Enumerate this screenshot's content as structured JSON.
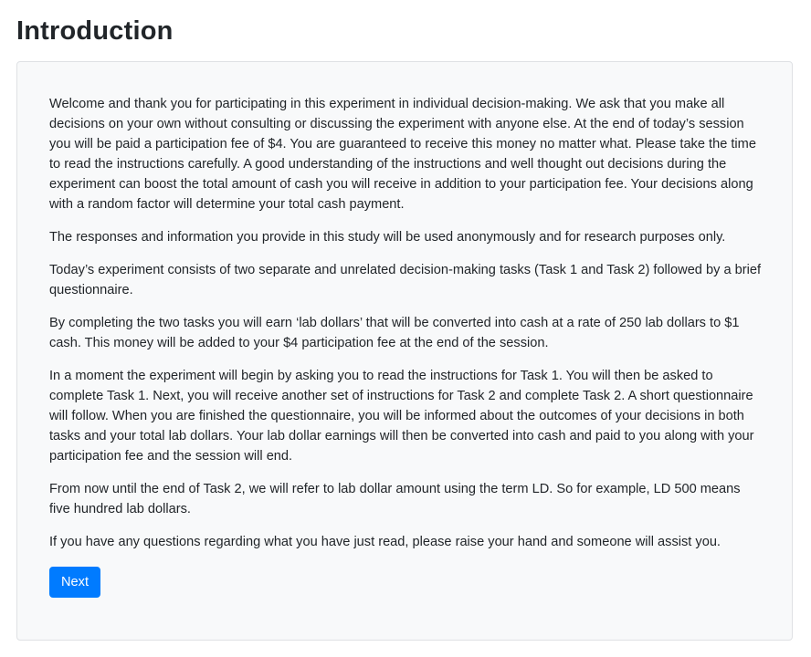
{
  "page": {
    "title": "Introduction"
  },
  "content": {
    "paragraphs": [
      "Welcome and thank you for participating in this experiment in individual decision-making. We ask that you make all decisions on your own without consulting or discussing the experiment with anyone else. At the end of today’s session you will be paid a participation fee of $4. You are guaranteed to receive this money no matter what. Please take the time to read the instructions carefully. A good understanding of the instructions and well thought out decisions during the experiment can boost the total amount of cash you will receive in addition to your participation fee. Your decisions along with a random factor will determine your total cash payment.",
      "The responses and information you provide in this study will be used anonymously and for research purposes only.",
      "Today’s experiment consists of two separate and unrelated decision-making tasks (Task 1 and Task 2) followed by a brief questionnaire.",
      "By completing the two tasks you will earn ‘lab dollars’ that will be converted into cash at a rate of 250 lab dollars to $1 cash. This money will be added to your $4 participation fee at the end of the session.",
      "In a moment the experiment will begin by asking you to read the instructions for Task 1. You will then be asked to complete Task 1. Next, you will receive another set of instructions for Task 2 and complete Task 2. A short questionnaire will follow. When you are finished the questionnaire, you will be informed about the outcomes of your decisions in both tasks and your total lab dollars. Your lab dollar earnings will then be converted into cash and paid to you along with your participation fee and the session will end.",
      "From now until the end of Task 2, we will refer to lab dollar amount using the term LD. So for example, LD 500 means five hundred lab dollars.",
      "If you have any questions regarding what you have just read, please raise your hand and someone will assist you."
    ]
  },
  "actions": {
    "next_label": "Next"
  },
  "colors": {
    "primary": "#007bff",
    "card_background": "#f8f9fa",
    "text": "#212529"
  }
}
